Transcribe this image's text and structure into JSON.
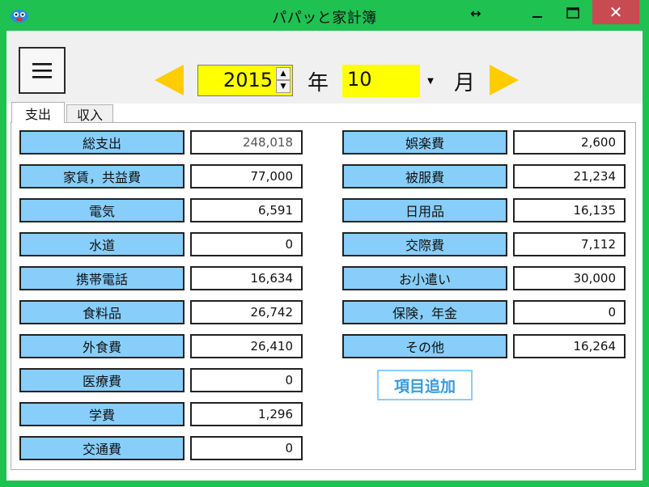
{
  "window": {
    "title": "パパッと家計簿",
    "close_glyph": "✕",
    "arrow_glyph": "↔"
  },
  "header": {
    "year": "2015",
    "year_label": "年",
    "month": "10",
    "month_label": "月"
  },
  "tabs": [
    {
      "label": "支出",
      "active": true
    },
    {
      "label": "収入",
      "active": false
    }
  ],
  "expenses_left": [
    {
      "label": "総支出",
      "value": "248,018"
    },
    {
      "label": "家賃，共益費",
      "value": "77,000"
    },
    {
      "label": "電気",
      "value": "6,591"
    },
    {
      "label": "水道",
      "value": "0"
    },
    {
      "label": "携帯電話",
      "value": "16,634"
    },
    {
      "label": "食料品",
      "value": "26,742"
    },
    {
      "label": "外食費",
      "value": "26,410"
    },
    {
      "label": "医療費",
      "value": "0"
    },
    {
      "label": "学費",
      "value": "1,296"
    },
    {
      "label": "交通費",
      "value": "0"
    }
  ],
  "expenses_right": [
    {
      "label": "娯楽費",
      "value": "2,600"
    },
    {
      "label": "被服費",
      "value": "21,234"
    },
    {
      "label": "日用品",
      "value": "16,135"
    },
    {
      "label": "交際費",
      "value": "7,112"
    },
    {
      "label": "お小遣い",
      "value": "30,000"
    },
    {
      "label": "保険，年金",
      "value": "0"
    },
    {
      "label": "その他",
      "value": "16,264"
    }
  ],
  "add_item_label": "項目追加",
  "colors": {
    "frame": "#1fc151",
    "category_bg": "#87cefa",
    "highlight": "#ffff00",
    "arrow": "#ffcc00",
    "close": "#c74b50"
  }
}
